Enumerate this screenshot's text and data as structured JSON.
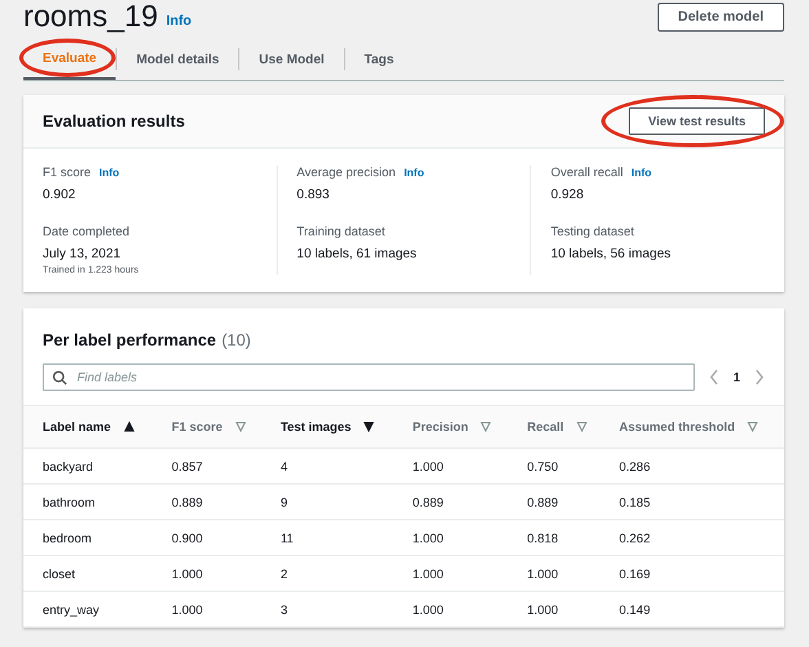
{
  "header": {
    "title": "rooms_19",
    "info": "Info",
    "delete_button": "Delete model"
  },
  "tabs": [
    {
      "label": "Evaluate",
      "selected": true,
      "annotated": true
    },
    {
      "label": "Model details",
      "selected": false,
      "annotated": false
    },
    {
      "label": "Use Model",
      "selected": false,
      "annotated": false
    },
    {
      "label": "Tags",
      "selected": false,
      "annotated": false
    }
  ],
  "evaluation": {
    "title": "Evaluation results",
    "button": "View test results",
    "button_annotated": true,
    "columns": [
      {
        "metric": {
          "label": "F1 score",
          "info": "Info",
          "value": "0.902"
        },
        "detail": {
          "label": "Date completed",
          "value": "July 13, 2021",
          "note": "Trained in 1.223 hours"
        }
      },
      {
        "metric": {
          "label": "Average precision",
          "info": "Info",
          "value": "0.893"
        },
        "detail": {
          "label": "Training dataset",
          "value": "10 labels, 61 images"
        }
      },
      {
        "metric": {
          "label": "Overall recall",
          "info": "Info",
          "value": "0.928"
        },
        "detail": {
          "label": "Testing dataset",
          "value": "10 labels, 56 images"
        }
      }
    ]
  },
  "performance": {
    "title": "Per label performance",
    "count": "(10)",
    "search": {
      "placeholder": "Find labels"
    },
    "page": "1",
    "table": {
      "columns": [
        {
          "label": "Label name",
          "sorted": true,
          "descending": false
        },
        {
          "label": "F1 score",
          "sorted": false,
          "descending": true
        },
        {
          "label": "Test images",
          "sorted": true,
          "descending": true
        },
        {
          "label": "Precision",
          "sorted": false,
          "descending": true
        },
        {
          "label": "Recall",
          "sorted": false,
          "descending": true
        },
        {
          "label": "Assumed threshold",
          "sorted": false,
          "descending": true
        }
      ],
      "rows": [
        [
          "backyard",
          "0.857",
          "4",
          "1.000",
          "0.750",
          "0.286"
        ],
        [
          "bathroom",
          "0.889",
          "9",
          "0.889",
          "0.889",
          "0.185"
        ],
        [
          "bedroom",
          "0.900",
          "11",
          "1.000",
          "0.818",
          "0.262"
        ],
        [
          "closet",
          "1.000",
          "2",
          "1.000",
          "1.000",
          "0.169"
        ],
        [
          "entry_way",
          "1.000",
          "3",
          "1.000",
          "1.000",
          "0.149"
        ]
      ]
    }
  }
}
